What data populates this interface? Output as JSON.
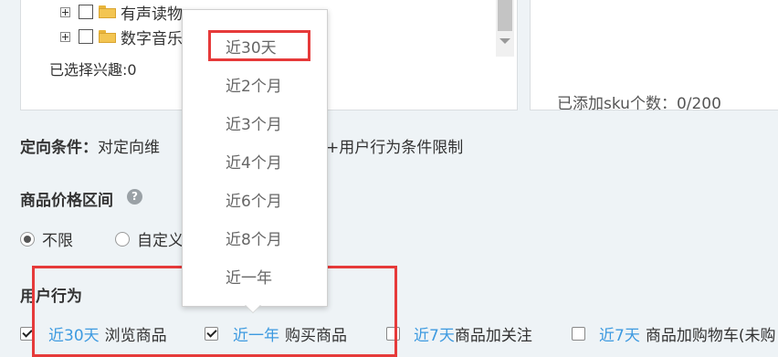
{
  "tree": {
    "items": [
      {
        "label": "有声读物"
      },
      {
        "label": "数字音乐"
      }
    ],
    "selected_interest": "已选择兴趣:0"
  },
  "sku": {
    "count_text": "已添加sku个数：0/200"
  },
  "targeting": {
    "title": "定向条件：",
    "desc_left": "对定向维",
    "desc_right": "+用户行为条件限制"
  },
  "price": {
    "title": "商品价格区间",
    "help": "?",
    "options": [
      {
        "label": "不限",
        "selected": true
      },
      {
        "label": "自定义",
        "selected": false
      }
    ]
  },
  "dropdown": {
    "items": [
      "近30天",
      "近2个月",
      "近3个月",
      "近4个月",
      "近6个月",
      "近8个月",
      "近一年"
    ],
    "highlighted": "近30天"
  },
  "behavior": {
    "title": "用户行为",
    "items": [
      {
        "checked": true,
        "period": "近30天",
        "action": "浏览商品"
      },
      {
        "checked": true,
        "period": "近一年",
        "action": "购买商品"
      },
      {
        "checked": false,
        "period": "近7天",
        "action": "商品加关注"
      },
      {
        "checked": false,
        "period": "近7天",
        "action": "商品加购物车(未购"
      }
    ]
  },
  "colors": {
    "link": "#3d9ae0",
    "highlight_box": "#e63a3a",
    "background": "#eef3f6"
  }
}
